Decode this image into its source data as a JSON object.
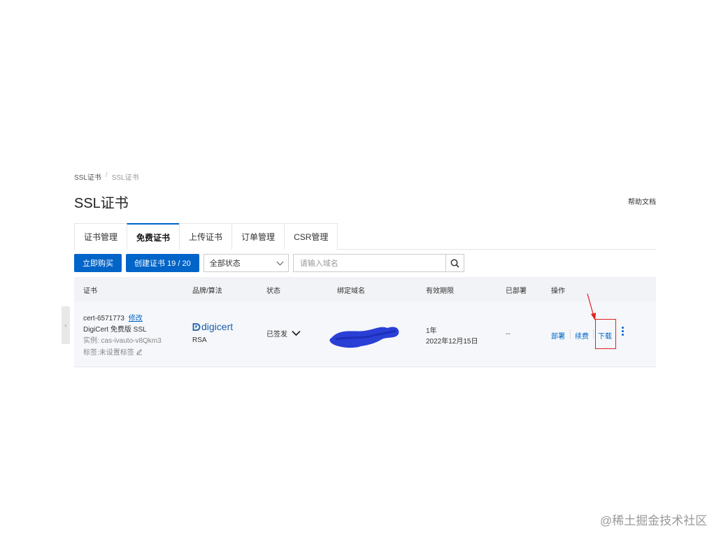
{
  "breadcrumb": {
    "root": "SSL证书",
    "separator": "/",
    "current": "SSL证书"
  },
  "page_title": "SSL证书",
  "help_link": "帮助文档",
  "tabs": [
    {
      "label": "证书管理",
      "active": false
    },
    {
      "label": "免费证书",
      "active": true
    },
    {
      "label": "上传证书",
      "active": false
    },
    {
      "label": "订单管理",
      "active": false
    },
    {
      "label": "CSR管理",
      "active": false
    }
  ],
  "toolbar": {
    "buy_label": "立即购买",
    "create_label": "创建证书 19 / 20",
    "status_select": "全部状态",
    "search_placeholder": "请输入域名"
  },
  "table": {
    "columns": [
      "证书",
      "品牌/算法",
      "状态",
      "绑定域名",
      "有效期限",
      "已部署",
      "操作"
    ],
    "row": {
      "cert_id": "cert-6571773",
      "edit_label": "修改",
      "cert_name": "DigiCert 免费版 SSL",
      "instance": "实例: cas-ivauto-v8Qkm3",
      "tag": "标签:未设置标签",
      "brand": "digicert",
      "algorithm": "RSA",
      "status": "已签发",
      "validity_period": "1年",
      "validity_date": "2022年12月15日",
      "deployed": "--",
      "actions": {
        "deploy": "部署",
        "renew": "续费",
        "download": "下载"
      }
    }
  },
  "watermark": "@稀土掘金技术社区",
  "colors": {
    "primary": "#0064c8",
    "highlight": "#e02020",
    "scribble": "#2a3fd6"
  }
}
